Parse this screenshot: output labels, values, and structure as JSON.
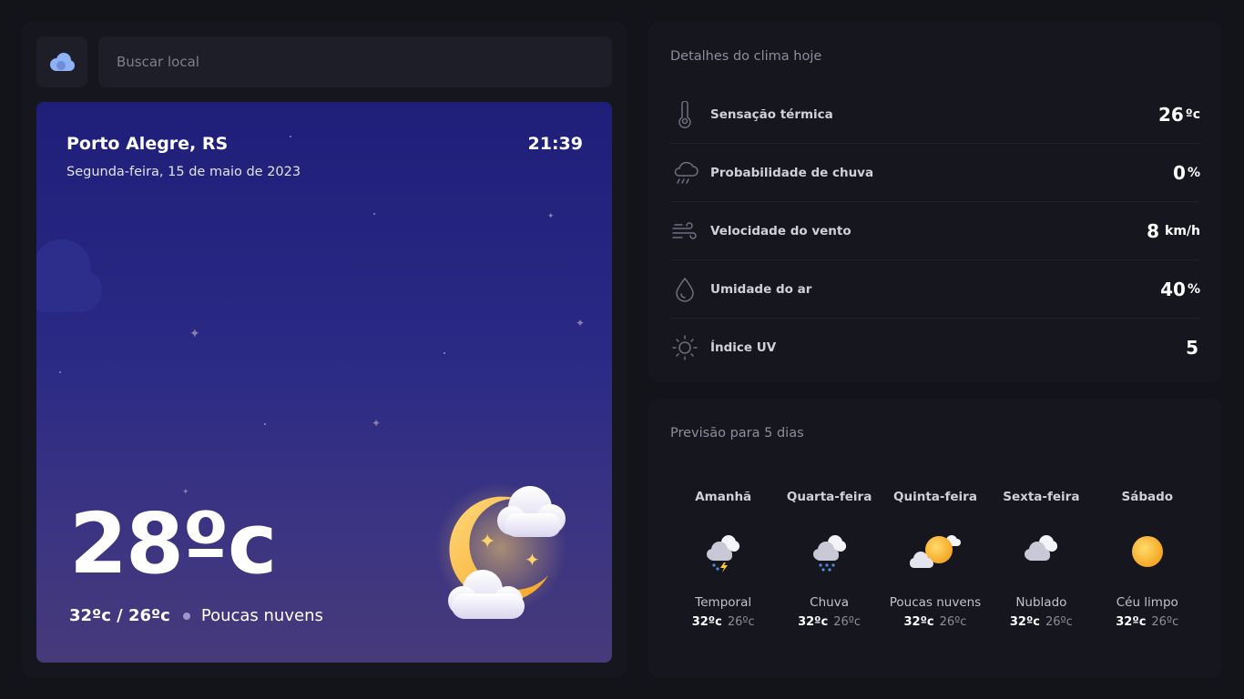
{
  "search": {
    "placeholder": "Buscar local",
    "logo_icon": "cloud-logo-icon"
  },
  "hero": {
    "city": "Porto Alegre, RS",
    "date": "Segunda-feira, 15 de maio de 2023",
    "time": "21:39",
    "temperature": "28ºc",
    "minmax": "32ºc / 26ºc",
    "condition": "Poucas nuvens",
    "icon": "moon-cloud-icon"
  },
  "details": {
    "title": "Detalhes do clima hoje",
    "rows": [
      {
        "label": "Sensação térmica",
        "value": "26",
        "unit": "ºc",
        "icon": "thermometer-icon"
      },
      {
        "label": "Probabilidade de chuva",
        "value": "0",
        "unit": "%",
        "icon": "cloud-rain-icon"
      },
      {
        "label": "Velocidade do vento",
        "value": "8",
        "unit": "km/h",
        "icon": "wind-icon"
      },
      {
        "label": "Umidade do ar",
        "value": "40",
        "unit": "%",
        "icon": "droplet-icon"
      },
      {
        "label": "Índice UV",
        "value": "5",
        "unit": "",
        "icon": "sun-icon"
      }
    ]
  },
  "forecast": {
    "title": "Previsão para 5 dias",
    "days": [
      {
        "name": "Amanhã",
        "condition": "Temporal",
        "max": "32ºc",
        "min": "26ºc",
        "icon": "storm-icon"
      },
      {
        "name": "Quarta-feira",
        "condition": "Chuva",
        "max": "32ºc",
        "min": "26ºc",
        "icon": "rain-icon"
      },
      {
        "name": "Quinta-feira",
        "condition": "Poucas nuvens",
        "max": "32ºc",
        "min": "26ºc",
        "icon": "sun-cloud-icon"
      },
      {
        "name": "Sexta-feira",
        "condition": "Nublado",
        "max": "32ºc",
        "min": "26ºc",
        "icon": "cloudy-icon"
      },
      {
        "name": "Sábado",
        "condition": "Céu limpo",
        "max": "32ºc",
        "min": "26ºc",
        "icon": "clear-sun-icon"
      }
    ]
  },
  "colors": {
    "background": "#13131a",
    "panel": "#16161f",
    "hero_top": "#1f1f7a",
    "hero_bottom": "#473a7a",
    "accent": "#8fb2f5"
  }
}
